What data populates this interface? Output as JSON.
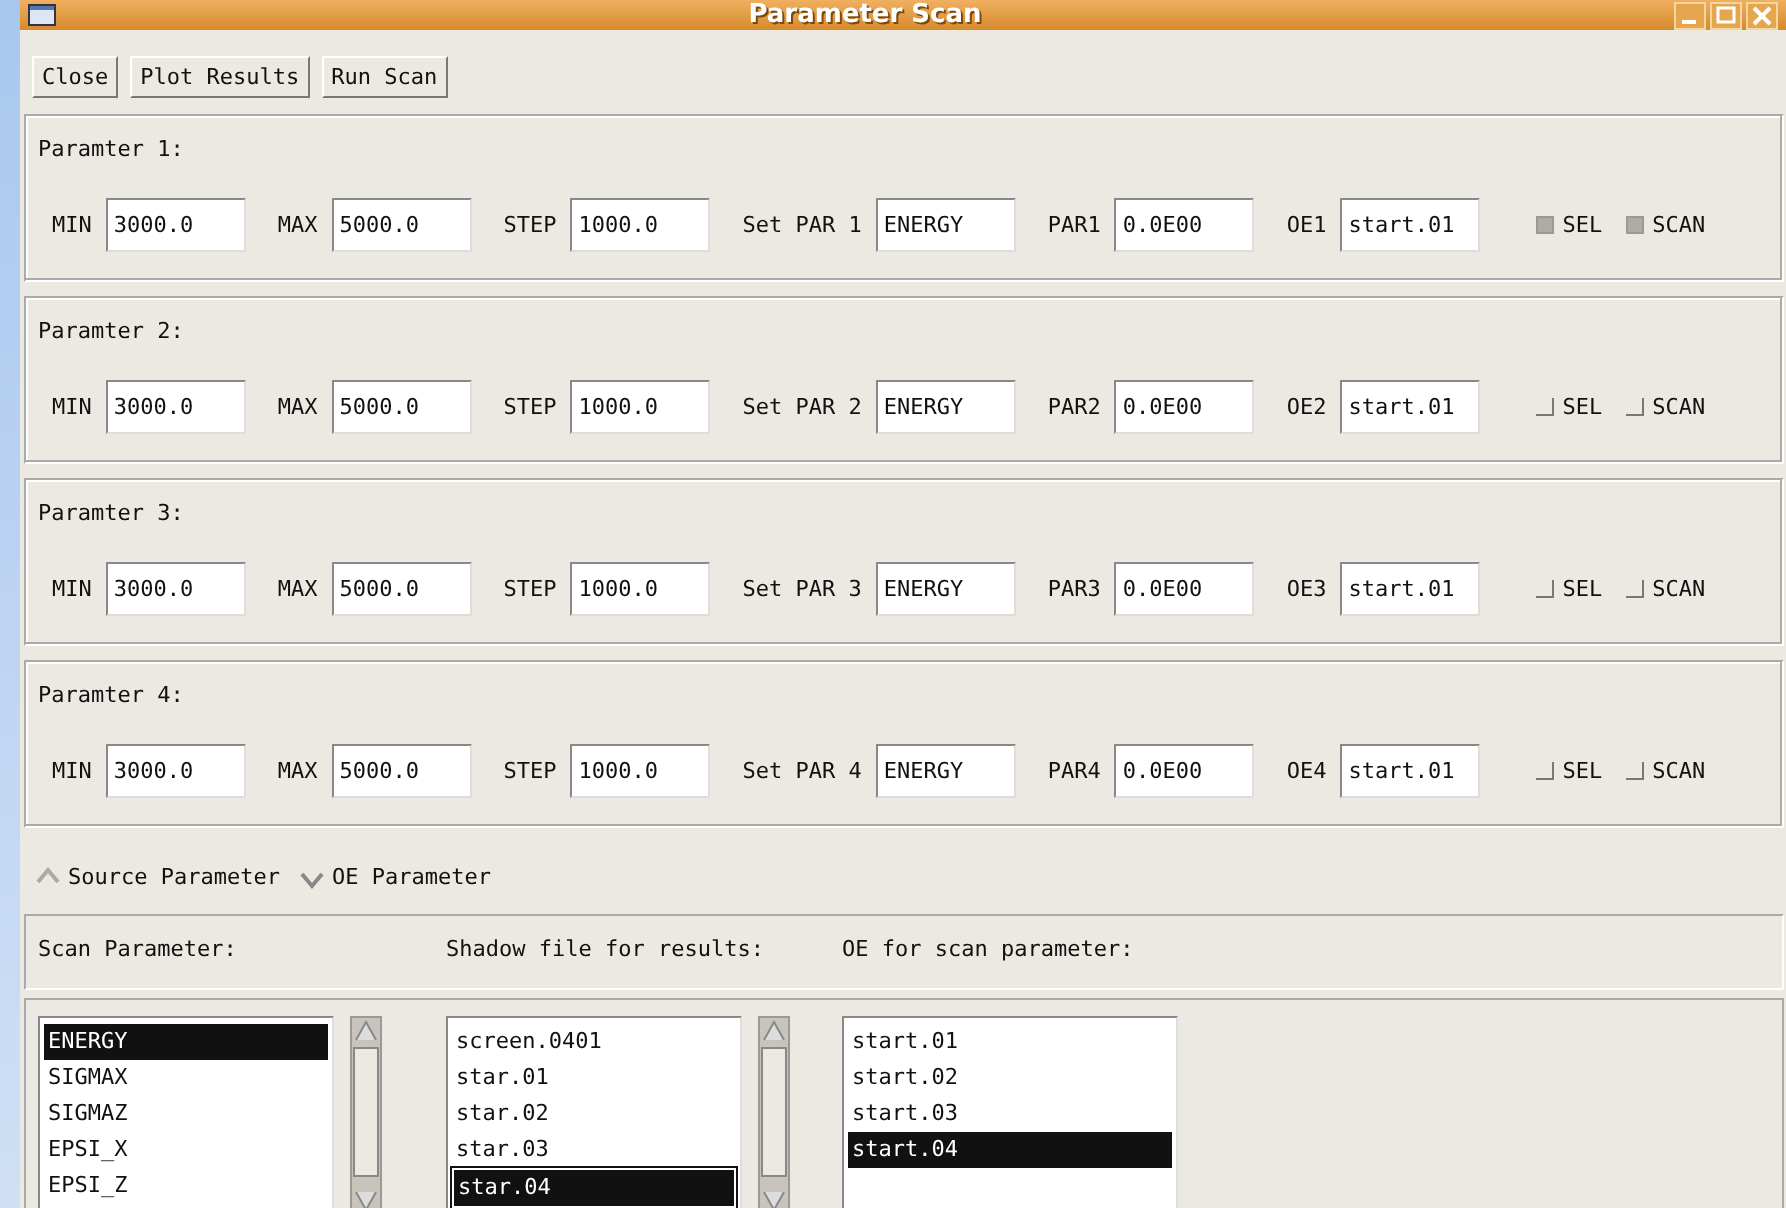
{
  "window": {
    "title": "Parameter Scan"
  },
  "toolbar": [
    "Close",
    "Plot Results",
    "Run Scan"
  ],
  "parameters": [
    {
      "title": "Paramter 1:",
      "min_label": "MIN",
      "min": "3000.0",
      "max_label": "MAX",
      "max": "5000.0",
      "step_label": "STEP",
      "step": "1000.0",
      "set_label": "Set PAR 1",
      "set": "ENERGY",
      "par_label": "PAR1",
      "par": "0.0E00",
      "oe_label": "OE1",
      "oe": "start.01",
      "sel": {
        "label": "SEL",
        "checked": true
      },
      "scan": {
        "label": "SCAN",
        "checked": true
      }
    },
    {
      "title": "Paramter 2:",
      "min_label": "MIN",
      "min": "3000.0",
      "max_label": "MAX",
      "max": "5000.0",
      "step_label": "STEP",
      "step": "1000.0",
      "set_label": "Set PAR 2",
      "set": "ENERGY",
      "par_label": "PAR2",
      "par": "0.0E00",
      "oe_label": "OE2",
      "oe": "start.01",
      "sel": {
        "label": "SEL",
        "checked": false
      },
      "scan": {
        "label": "SCAN",
        "checked": false
      }
    },
    {
      "title": "Paramter 3:",
      "min_label": "MIN",
      "min": "3000.0",
      "max_label": "MAX",
      "max": "5000.0",
      "step_label": "STEP",
      "step": "1000.0",
      "set_label": "Set PAR 3",
      "set": "ENERGY",
      "par_label": "PAR3",
      "par": "0.0E00",
      "oe_label": "OE3",
      "oe": "start.01",
      "sel": {
        "label": "SEL",
        "checked": false
      },
      "scan": {
        "label": "SCAN",
        "checked": false
      }
    },
    {
      "title": "Paramter 4:",
      "min_label": "MIN",
      "min": "3000.0",
      "max_label": "MAX",
      "max": "5000.0",
      "step_label": "STEP",
      "step": "1000.0",
      "set_label": "Set PAR 4",
      "set": "ENERGY",
      "par_label": "PAR4",
      "par": "0.0E00",
      "oe_label": "OE4",
      "oe": "start.01",
      "sel": {
        "label": "SEL",
        "checked": false
      },
      "scan": {
        "label": "SCAN",
        "checked": false
      }
    }
  ],
  "source_radio": [
    {
      "label": "Source Parameter",
      "selected": false
    },
    {
      "label": "OE Parameter",
      "selected": true
    }
  ],
  "lists": [
    {
      "header": "Scan Parameter:",
      "scrollbar": true,
      "items": [
        {
          "label": "ENERGY",
          "selected": true
        },
        {
          "label": "SIGMAX",
          "selected": false
        },
        {
          "label": "SIGMAZ",
          "selected": false
        },
        {
          "label": "EPSI_X",
          "selected": false
        },
        {
          "label": "EPSI_Z",
          "selected": false
        }
      ]
    },
    {
      "header": "Shadow file for results:",
      "scrollbar": true,
      "items": [
        {
          "label": "screen.0401",
          "selected": false
        },
        {
          "label": "star.01",
          "selected": false
        },
        {
          "label": "star.02",
          "selected": false
        },
        {
          "label": "star.03",
          "selected": false
        },
        {
          "label": "star.04",
          "selected": true
        }
      ]
    },
    {
      "header": "OE for scan parameter:",
      "scrollbar": false,
      "items": [
        {
          "label": "start.01",
          "selected": false
        },
        {
          "label": "start.02",
          "selected": false
        },
        {
          "label": "start.03",
          "selected": false
        },
        {
          "label": "start.04",
          "selected": true
        }
      ]
    }
  ]
}
